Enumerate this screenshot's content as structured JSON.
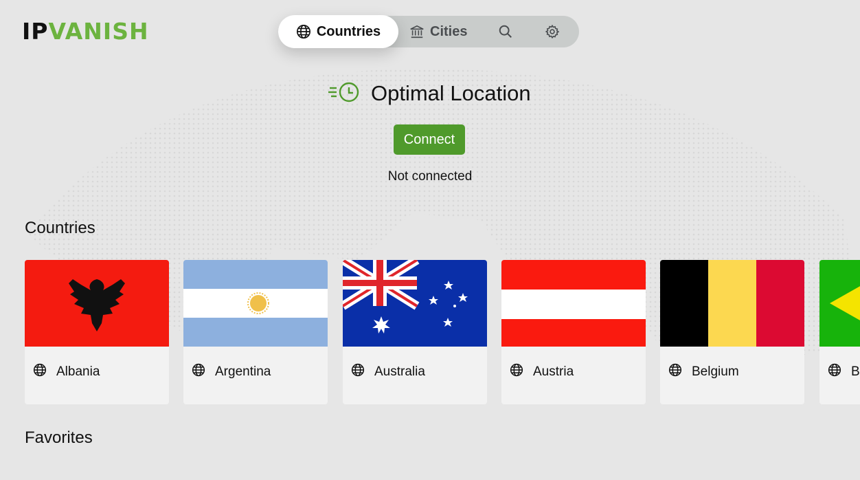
{
  "logo": {
    "ip": "IP",
    "vanish": "VANISH"
  },
  "tabs": {
    "countries": "Countries",
    "cities": "Cities"
  },
  "optimal": {
    "title": "Optimal Location",
    "connect_label": "Connect",
    "status": "Not connected"
  },
  "sections": {
    "countries": "Countries",
    "favorites": "Favorites"
  },
  "countries": [
    {
      "name": "Albania",
      "flag": "albania"
    },
    {
      "name": "Argentina",
      "flag": "argentina"
    },
    {
      "name": "Australia",
      "flag": "australia"
    },
    {
      "name": "Austria",
      "flag": "austria"
    },
    {
      "name": "Belgium",
      "flag": "belgium"
    },
    {
      "name": "B",
      "flag": "brazil"
    }
  ],
  "colors": {
    "brand_green": "#6cb33f",
    "connect_green": "#4f9a2b",
    "background": "#e6e6e6"
  },
  "icons": [
    "globe-icon",
    "bank-icon",
    "search-icon",
    "gear-icon",
    "fast-clock-icon"
  ]
}
